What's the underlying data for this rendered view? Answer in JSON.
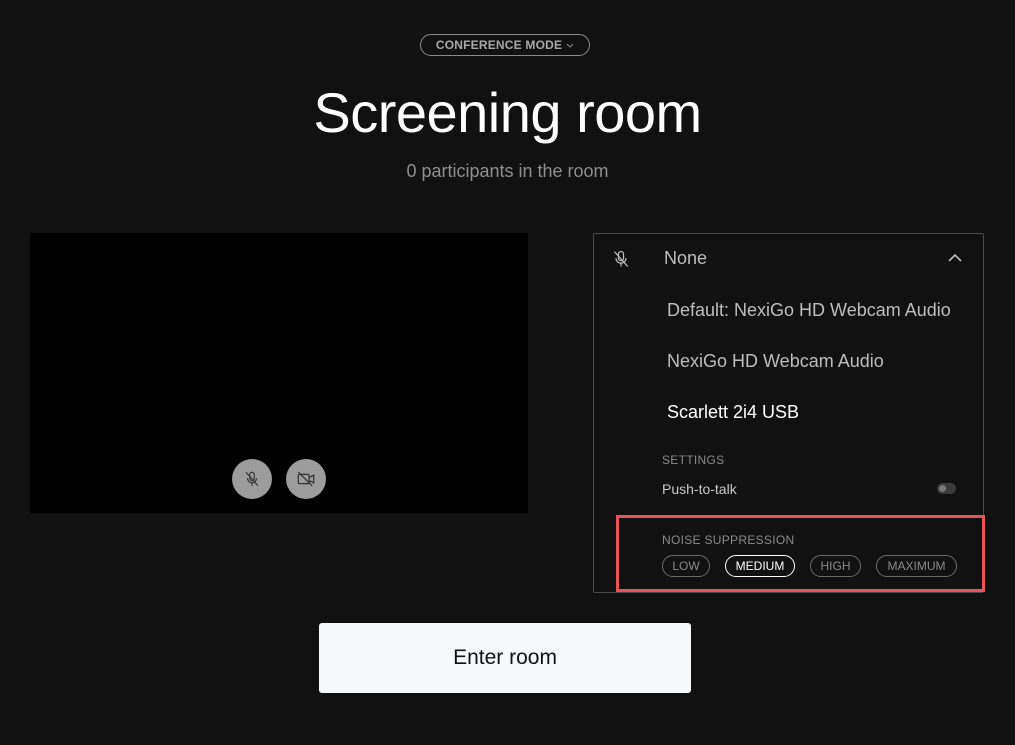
{
  "header": {
    "mode_label": "CONFERENCE MODE",
    "title": "Screening room",
    "participants_text": "0 participants in the room"
  },
  "preview": {
    "mic_button_icon": "mic-off-icon",
    "camera_button_icon": "camera-off-icon"
  },
  "audio_dropdown": {
    "selected": "None",
    "expanded": true,
    "options": [
      "Default: NexiGo HD Webcam Audio",
      "NexiGo HD Webcam Audio",
      "Scarlett 2i4 USB"
    ],
    "settings_heading": "SETTINGS",
    "push_to_talk_label": "Push-to-talk",
    "push_to_talk_on": false,
    "noise_suppression_heading": "NOISE SUPPRESSION",
    "noise_levels": [
      "LOW",
      "MEDIUM",
      "HIGH",
      "MAXIMUM"
    ],
    "noise_selected": "MEDIUM"
  },
  "actions": {
    "enter_label": "Enter room"
  },
  "colors": {
    "background": "#111111",
    "highlight": "#e8525a",
    "button_bg": "#f7f8fa"
  }
}
